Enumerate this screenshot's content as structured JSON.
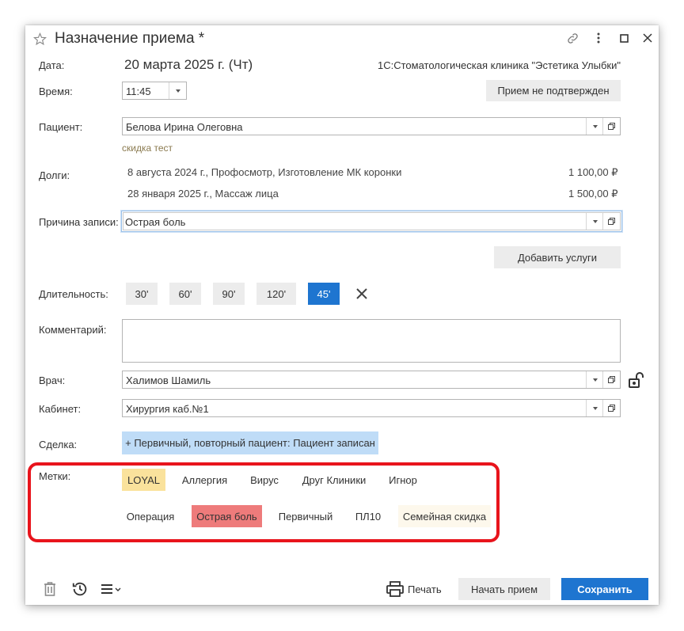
{
  "header": {
    "title": "Назначение приема *"
  },
  "form": {
    "date_label": "Дата:",
    "date_value": "20 марта 2025 г. (Чт)",
    "clinic": "1С:Стоматологическая клиника \"Эстетика Улыбки\"",
    "time_label": "Время:",
    "time_value": "11:45",
    "status_button": "Прием не подтвержден",
    "patient_label": "Пациент:",
    "patient_value": "Белова Ирина Олеговна",
    "patient_discount": "скидка тест",
    "debts_label": "Долги:",
    "debts": [
      {
        "desc": "8 августа 2024 г., Профосмотр, Изготовление МК коронки",
        "amount": "1 100,00 ₽"
      },
      {
        "desc": "28 января 2025 г., Массаж лица",
        "amount": "1 500,00 ₽"
      }
    ],
    "reason_label": "Причина записи:",
    "reason_value": "Острая боль",
    "add_services_button": "Добавить услуги",
    "duration_label": "Длительность:",
    "durations": [
      "30'",
      "60'",
      "90'",
      "120'",
      "45'"
    ],
    "duration_selected": "45'",
    "comment_label": "Комментарий:",
    "comment_value": "",
    "doctor_label": "Врач:",
    "doctor_value": "Халимов Шамиль",
    "cabinet_label": "Кабинет:",
    "cabinet_value": "Хирургия каб.№1",
    "deal_label": "Сделка:",
    "deal_value": "+ Первичный, повторный пациент: Пациент записан",
    "tags_label": "Метки:",
    "tags_row1": [
      "LOYAL",
      "Аллергия",
      "Вирус",
      "Друг Клиники",
      "Игнор"
    ],
    "tags_row2": [
      "Операция",
      "Острая боль",
      "Первичный",
      "ПЛ10",
      "Семейная скидка"
    ]
  },
  "footer": {
    "print_label": "Печать",
    "start_button": "Начать прием",
    "save_button": "Сохранить"
  },
  "colors": {
    "primary": "#1e75d0",
    "tag_loyal": "#fae29c",
    "tag_active": "#ee7b7b",
    "tag_family": "#fdf8ec",
    "deal_bg": "#bfdcf7",
    "highlight_border": "#e8141c"
  },
  "icons": [
    "star-icon",
    "link-icon",
    "more-icon",
    "maximize-icon",
    "close-icon",
    "lock-open-icon",
    "trash-icon",
    "history-icon",
    "menu-icon",
    "printer-icon",
    "open-icon",
    "chevron-down-icon"
  ]
}
